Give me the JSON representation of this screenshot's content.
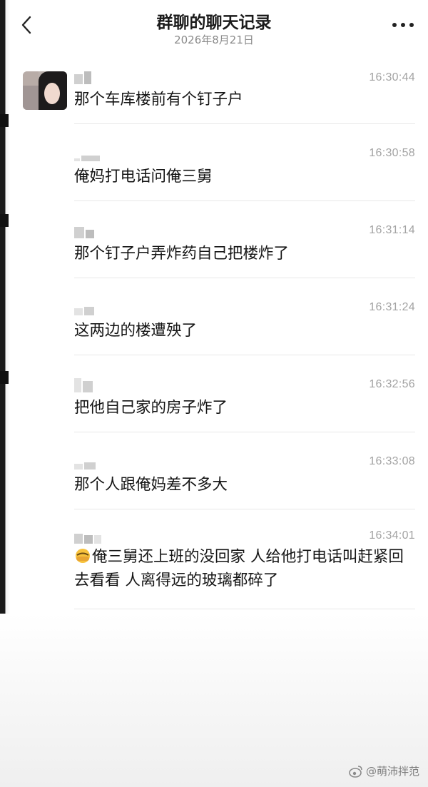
{
  "header": {
    "title": "群聊的聊天记录",
    "date": "2026年8月21日"
  },
  "messages": [
    {
      "time": "16:30:44",
      "text": "那个车库楼前有个钉子户"
    },
    {
      "time": "16:30:58",
      "text": "俺妈打电话问俺三舅"
    },
    {
      "time": "16:31:14",
      "text": "那个钉子户弄炸药自己把楼炸了"
    },
    {
      "time": "16:31:24",
      "text": "这两边的楼遭殃了"
    },
    {
      "time": "16:32:56",
      "text": "把他自己家的房子炸了"
    },
    {
      "time": "16:33:08",
      "text": "那个人跟俺妈差不多大"
    },
    {
      "time": "16:34:01",
      "text": "俺三舅还上班的没回家 人给他打电话叫赶紧回去看看 人离得远的玻璃都碎了"
    }
  ],
  "watermark": {
    "text": "@萌沛拌范",
    "icon": "weibo-icon"
  },
  "icons": {
    "back": "back-icon",
    "more": "more-icon"
  }
}
